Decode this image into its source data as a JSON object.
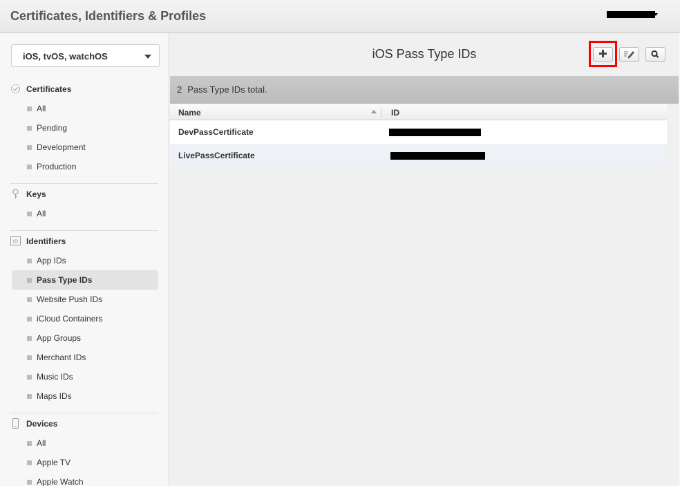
{
  "header": {
    "app_title": "Certificates, Identifiers & Profiles"
  },
  "sidebar": {
    "platform": "iOS, tvOS, watchOS",
    "sections": [
      {
        "title": "Certificates",
        "icon": "certificate-icon",
        "items": [
          "All",
          "Pending",
          "Development",
          "Production"
        ]
      },
      {
        "title": "Keys",
        "icon": "key-icon",
        "items": [
          "All"
        ]
      },
      {
        "title": "Identifiers",
        "icon": "id-icon",
        "items": [
          "App IDs",
          "Pass Type IDs",
          "Website Push IDs",
          "iCloud Containers",
          "App Groups",
          "Merchant IDs",
          "Music IDs",
          "Maps IDs"
        ],
        "active": "Pass Type IDs"
      },
      {
        "title": "Devices",
        "icon": "device-icon",
        "items": [
          "All",
          "Apple TV",
          "Apple Watch"
        ]
      }
    ]
  },
  "main": {
    "title": "iOS Pass Type IDs",
    "toolbar": {
      "add": "plus-icon",
      "edit": "edit-icon",
      "search": "search-icon",
      "highlight_color": "#ff0000"
    },
    "summary": {
      "count": "2",
      "label": "Pass Type IDs total."
    },
    "table": {
      "columns": [
        "Name",
        "ID"
      ],
      "rows": [
        {
          "name": "DevPassCertificate"
        },
        {
          "name": "LivePassCertificate"
        }
      ]
    }
  }
}
